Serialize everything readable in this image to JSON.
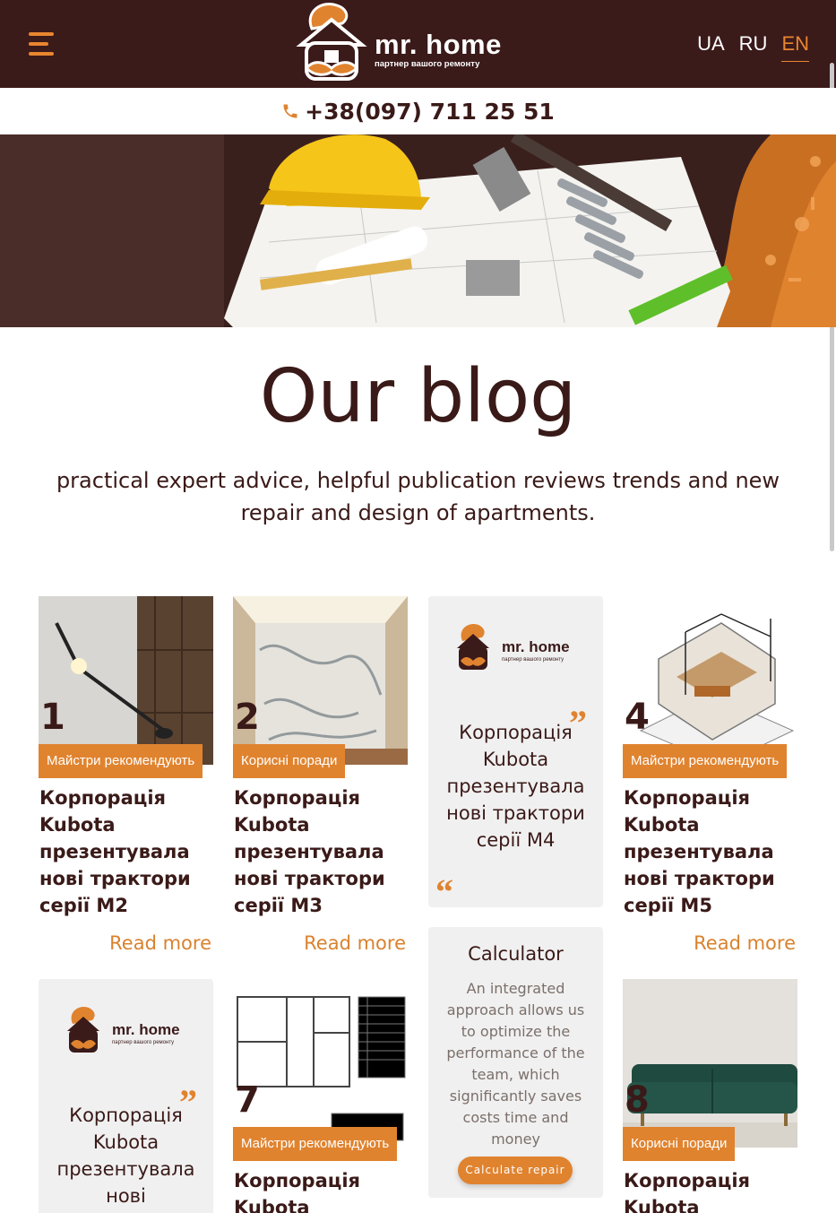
{
  "header": {
    "logo_title": "mr. home",
    "logo_subtitle": "партнер вашого ремонту",
    "languages": [
      "UA",
      "RU",
      "EN"
    ],
    "active_language": "EN"
  },
  "contact": {
    "phone": "+38(097) 711 25 51"
  },
  "page": {
    "title": "Our blog",
    "subtitle": "practical expert advice, helpful publication reviews trends and new repair and design of apartments."
  },
  "cards": [
    {
      "number": "1",
      "tag": "Майстри рекомендують",
      "title": "Корпорація Kubota презентувала нові трактори серії M2",
      "read_more": "Read more"
    },
    {
      "number": "2",
      "tag": "Корисні поради",
      "title": "Корпорація Kubota презентувала нові трактори серії M3",
      "read_more": "Read more"
    },
    {
      "quote": "Корпорація Kubota презентувала нові трактори серії M4"
    },
    {
      "number": "4",
      "tag": "Майстри рекомендують",
      "title": "Корпорація Kubota презентувала нові трактори серії M5",
      "read_more": "Read more"
    },
    {
      "quote": "Корпорація Kubota презентувала нові"
    },
    {
      "number": "7",
      "tag": "Майстри рекомендують",
      "title": "Корпорація Kubota"
    },
    {
      "number": "8",
      "tag": "Корисні поради",
      "title": "Корпорація Kubota"
    }
  ],
  "calculator": {
    "title": "Calculator",
    "text": "An integrated approach allows us to optimize the performance of the team, which significantly saves costs time and money",
    "button": "Calculate repair"
  },
  "colors": {
    "brand_dark": "#3b1a1a",
    "accent": "#e0832f"
  }
}
